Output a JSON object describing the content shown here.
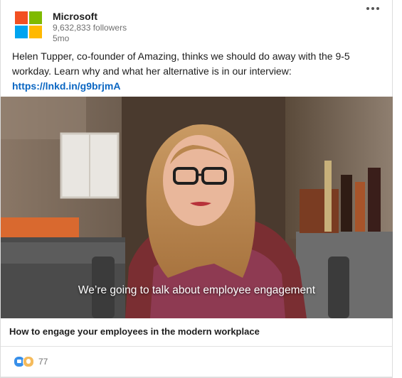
{
  "post": {
    "company": "Microsoft",
    "followers": "9,632,833 followers",
    "age": "5mo",
    "body": "Helen Tupper, co-founder of Amazing, thinks we should do away with the 9-5 workday. Learn why and what her alternative is in our interview:",
    "link": "https://lnkd.in/g9brjmA"
  },
  "video": {
    "caption": "We’re going to talk about employee engagement"
  },
  "article": {
    "title": "How to engage your employees in the modern workplace"
  },
  "social": {
    "reaction_count": "77",
    "reaction_icons": [
      "like-icon",
      "insightful-icon"
    ]
  },
  "colors": {
    "link": "#0a66c2",
    "like": "#378fe9",
    "insightful": "#f5bb5c"
  }
}
